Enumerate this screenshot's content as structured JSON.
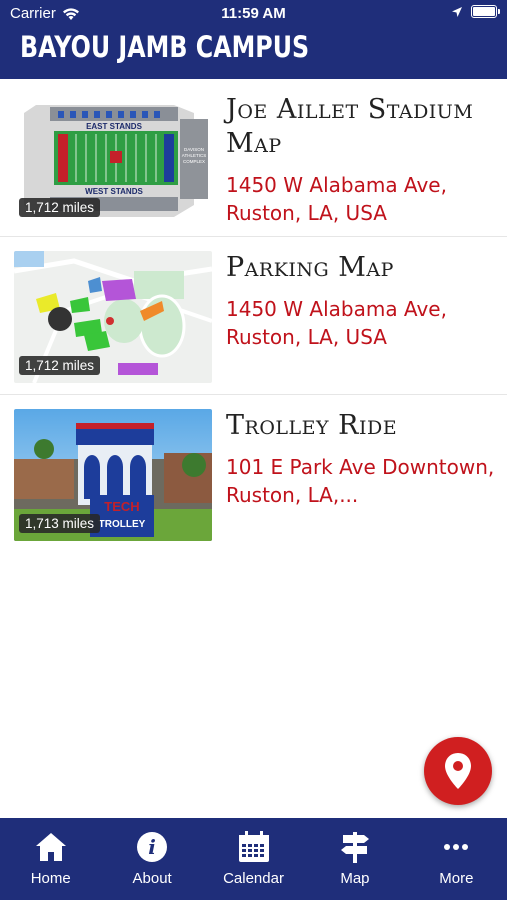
{
  "status": {
    "carrier": "Carrier",
    "time": "11:59 AM"
  },
  "header": {
    "title": "BAYOU JAMB CAMPUS"
  },
  "items": [
    {
      "title": "Joe Aillet Stadium Map",
      "address": "1450 W Alabama Ave, Ruston, LA, USA",
      "distance": "1,712 miles",
      "thumb_labels": {
        "top": "EAST STANDS",
        "bottom": "WEST STANDS",
        "side1": "DAVISON",
        "side2": "ATHLETICS",
        "side3": "COMPLEX"
      }
    },
    {
      "title": "Parking Map",
      "address": "1450 W Alabama Ave, Ruston, LA, USA",
      "distance": "1,712 miles"
    },
    {
      "title": "Trolley Ride",
      "address": "101 E Park Ave Downtown, Ruston, LA,...",
      "distance": "1,713 miles",
      "thumb_labels": {
        "sign1": "TECH",
        "sign2": "TROLLEY"
      }
    }
  ],
  "tabs": [
    {
      "label": "Home",
      "icon": "home-icon"
    },
    {
      "label": "About",
      "icon": "info-icon"
    },
    {
      "label": "Calendar",
      "icon": "calendar-icon"
    },
    {
      "label": "Map",
      "icon": "signpost-icon"
    },
    {
      "label": "More",
      "icon": "more-icon"
    }
  ],
  "colors": {
    "brand_navy": "#1f2e7a",
    "accent_red": "#c0121b",
    "fab_red": "#d01f20"
  }
}
